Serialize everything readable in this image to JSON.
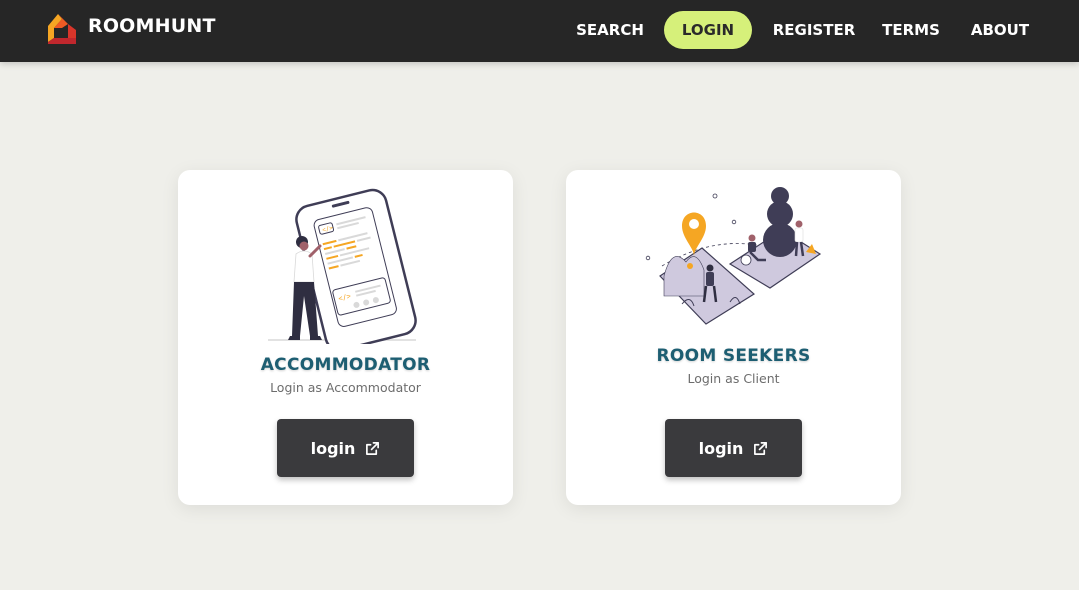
{
  "brand": {
    "name": "ROOMHUNT",
    "logo_icon": "house-logo-icon"
  },
  "nav": {
    "search": "SEARCH",
    "login": "LOGIN",
    "register": "REGISTER",
    "terms": "TERMS",
    "about": "ABOUT",
    "active": "LOGIN"
  },
  "cards": [
    {
      "title": "ACCOMMODATOR",
      "subtitle": "Login as Accommodator",
      "button_label": "login",
      "button_icon": "external-link-icon",
      "illustration": "person-with-phone-illustration"
    },
    {
      "title": "ROOM SEEKERS",
      "subtitle": "Login as Client",
      "button_label": "login",
      "button_icon": "external-link-icon",
      "illustration": "location-search-illustration"
    }
  ],
  "colors": {
    "navbar": "#262626",
    "active_nav": "#d6f07a",
    "page_bg": "#efefea",
    "card_title": "#1d5e72",
    "button": "#3a3a3d",
    "accent_yellow": "#f5a623",
    "illustration_purple": "#cfc9de"
  }
}
